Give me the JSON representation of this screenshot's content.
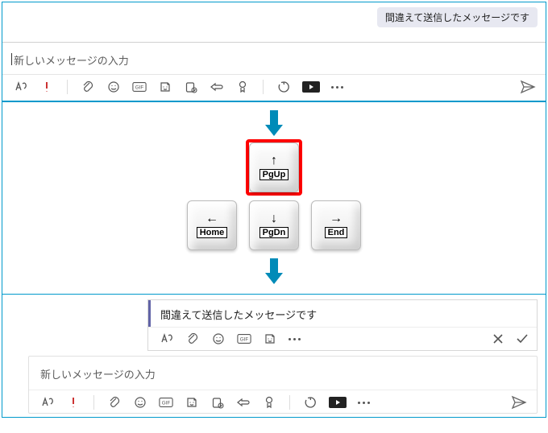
{
  "panel1": {
    "sent_message": "間違えて送信したメッセージです",
    "placeholder": "新しいメッセージの入力"
  },
  "keys": {
    "up": {
      "glyph": "↑",
      "label": "PgUp"
    },
    "down": {
      "glyph": "↓",
      "label": "PgDn"
    },
    "left": {
      "glyph": "←",
      "label": "Home"
    },
    "right": {
      "glyph": "→",
      "label": "End"
    },
    "highlighted": "up"
  },
  "panel2": {
    "editing_text": "間違えて送信したメッセージです",
    "placeholder": "新しいメッセージの入力"
  },
  "icons": {
    "format": "format-icon",
    "priority": "priority-icon",
    "attach": "attach-icon",
    "emoji": "emoji-icon",
    "gif": "gif-icon",
    "sticker": "sticker-icon",
    "approvals": "approvals-icon",
    "loop": "loop-icon",
    "praise": "praise-icon",
    "actions": "actions-icon",
    "video": "stream-icon",
    "more": "more-icon",
    "send": "send-icon",
    "cancel": "cancel-icon",
    "confirm": "confirm-icon"
  }
}
